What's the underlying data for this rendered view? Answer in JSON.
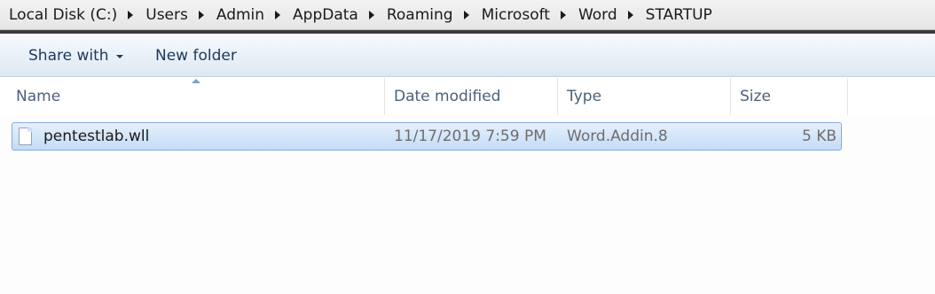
{
  "address_bar": {
    "crumbs": [
      "Local Disk (C:)",
      "Users",
      "Admin",
      "AppData",
      "Roaming",
      "Microsoft",
      "Word",
      "STARTUP"
    ]
  },
  "command_bar": {
    "share_with_label": "Share with",
    "new_folder_label": "New folder"
  },
  "columns": {
    "name": "Name",
    "date_modified": "Date modified",
    "type": "Type",
    "size": "Size"
  },
  "files": [
    {
      "name": "pentestlab.wll",
      "date_modified": "11/17/2019 7:59 PM",
      "type": "Word.Addin.8",
      "size": "5 KB",
      "icon": "file-icon"
    }
  ],
  "colors": {
    "selection_border": "#84acdd",
    "selection_fill": "#d3e5fa",
    "command_text": "#1e395b"
  }
}
